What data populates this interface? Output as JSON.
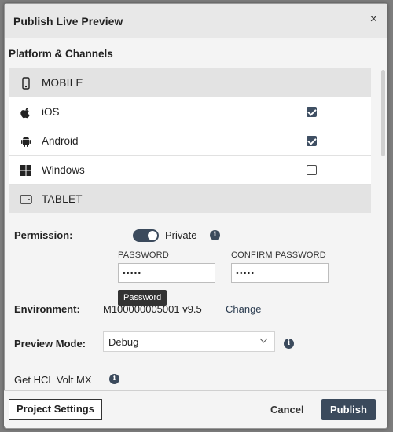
{
  "dialog": {
    "title": "Publish Live Preview",
    "close_glyph": "×"
  },
  "platforms_section": {
    "title": "Platform & Channels",
    "rows": [
      {
        "type": "group",
        "label": "MOBILE",
        "icon": "mobile-phone-icon"
      },
      {
        "type": "item",
        "label": "iOS",
        "icon": "apple-icon",
        "checked": true
      },
      {
        "type": "item",
        "label": "Android",
        "icon": "android-icon",
        "checked": true
      },
      {
        "type": "item",
        "label": "Windows",
        "icon": "windows-icon",
        "checked": false
      },
      {
        "type": "group",
        "label": "TABLET",
        "icon": "tablet-icon"
      }
    ]
  },
  "permission": {
    "label": "Permission:",
    "private_label": "Private",
    "private_enabled": true,
    "password_label": "PASSWORD",
    "password_value": "•••••",
    "confirm_label": "CONFIRM PASSWORD",
    "confirm_value": "•••••",
    "tooltip": "Password"
  },
  "environment": {
    "label": "Environment:",
    "value": "M100000005001 v9.5",
    "change_label": "Change"
  },
  "preview_mode": {
    "label": "Preview Mode:",
    "selected": "Debug"
  },
  "get_volt": {
    "label": "Get HCL Volt MX"
  },
  "footer": {
    "project_settings": "Project Settings",
    "cancel": "Cancel",
    "publish": "Publish"
  },
  "colors": {
    "accent": "#3b4a5c",
    "group_row_bg": "#e3e3e3",
    "dialog_bg": "#f4f4f4"
  }
}
